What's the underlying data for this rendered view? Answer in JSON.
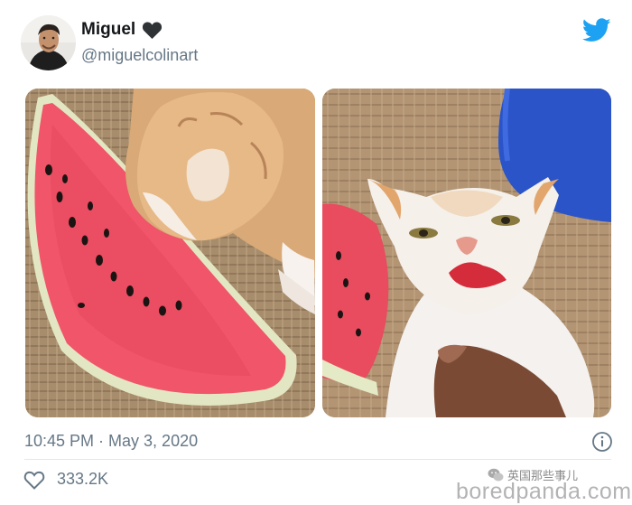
{
  "header": {
    "display_name": "Miguel",
    "name_badge_icon": "black-heart-icon",
    "handle": "@miguelcolinart",
    "platform_icon": "twitter-bird-icon",
    "brand_color": "#1da1f2"
  },
  "media": {
    "photos": [
      {
        "subject": "orange-white-kitten-eating-watermelon"
      },
      {
        "subject": "kitten-with-red-watermelon-lips"
      }
    ]
  },
  "footer": {
    "timestamp": "10:45 PM · May 3, 2020",
    "info_icon": "info-icon",
    "like_icon": "heart-outline-icon",
    "like_count": "333.2K",
    "wechat_label": "英国那些事儿",
    "watermark": "boredpanda.com"
  },
  "colors": {
    "text_primary": "#14171a",
    "text_secondary": "#657786",
    "divider": "#e1e8ed"
  }
}
